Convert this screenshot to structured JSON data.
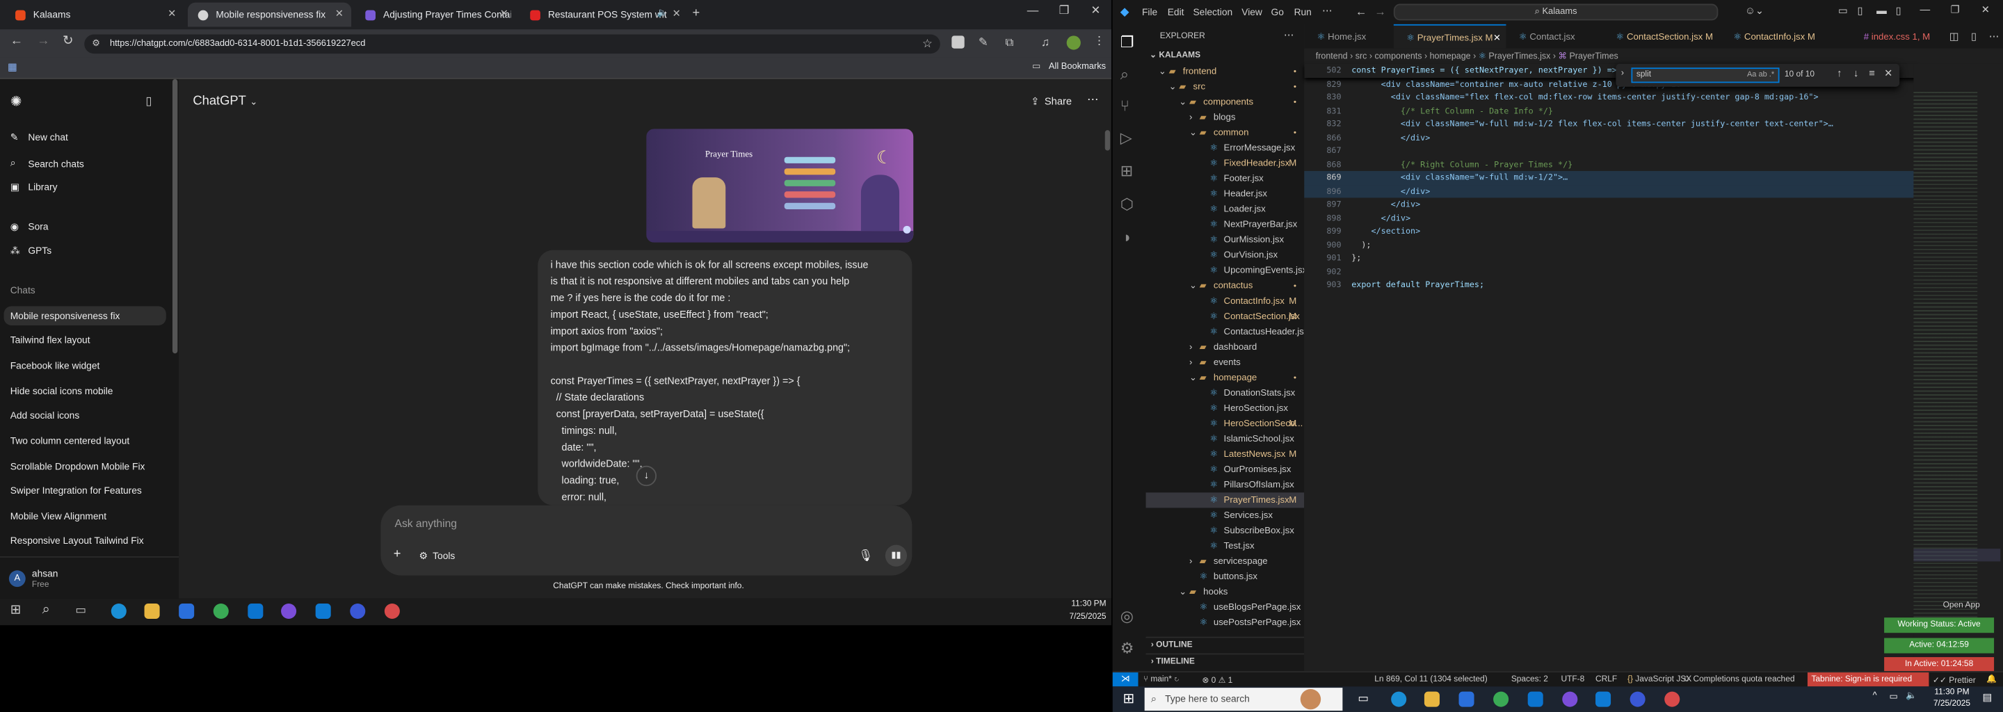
{
  "browser": {
    "tabs": [
      {
        "title": "Kalaams",
        "color": "#e84a1c"
      },
      {
        "title": "Mobile responsiveness fix",
        "color": "#d5d5d5"
      },
      {
        "title": "Adjusting Prayer Times Contain",
        "color": "#7a5bd8"
      },
      {
        "title": "Restaurant POS System wit",
        "color": "#e02424"
      }
    ],
    "url": "https://chatgpt.com/c/6883add0-6314-8001-b1d1-356619227ecd",
    "bookmarks_label": "All Bookmarks"
  },
  "chatgpt": {
    "model_label": "ChatGPT",
    "share_label": "Share",
    "nav": [
      "New chat",
      "Search chats",
      "Library",
      "Sora",
      "GPTs"
    ],
    "chats_heading": "Chats",
    "chats": [
      "Mobile responsiveness fix",
      "Tailwind flex layout",
      "Facebook like widget",
      "Hide social icons mobile",
      "Add social icons",
      "Two column centered layout",
      "Scrollable Dropdown Mobile Fix",
      "Swiper Integration for Features",
      "Mobile View Alignment",
      "Responsive Layout Tailwind Fix"
    ],
    "user": {
      "initial": "A",
      "name": "ahsan",
      "plan": "Free"
    },
    "image_title": "Prayer Times",
    "message_lines": [
      "i have this section code which is ok for all screens except mobiles, issue",
      "is that it is  not responsive at different mobiles and tabs can you help",
      "me ? if yes here is the code do it for me :",
      "import React, { useState, useEffect } from \"react\";",
      "import axios from \"axios\";",
      "import bgImage from \"../../assets/images/Homepage/namazbg.png\";",
      "",
      "const PrayerTimes = ({ setNextPrayer, nextPrayer }) => {",
      "  // State declarations",
      "  const [prayerData, setPrayerData] = useState({",
      "    timings: null,",
      "    date: \"\",",
      "    worldwideDate: \"\",",
      "    loading: true,",
      "    error: null,"
    ],
    "composer_placeholder": "Ask anything",
    "tools_label": "Tools",
    "disclaimer": "ChatGPT can make mistakes. Check important info."
  },
  "taskbar_left": {
    "time": "11:30 PM",
    "date": "7/25/2025"
  },
  "vscode": {
    "menu": [
      "File",
      "Edit",
      "Selection",
      "View",
      "Go",
      "Run"
    ],
    "search_box": "Kalaams",
    "explorer_title": "EXPLORER",
    "root": "KALAAMS",
    "tree": [
      {
        "label": "frontend",
        "depth": 1,
        "type": "folder-open",
        "mod": "dot"
      },
      {
        "label": "src",
        "depth": 2,
        "type": "folder-open",
        "mod": "dot"
      },
      {
        "label": "components",
        "depth": 3,
        "type": "folder-open",
        "mod": "dot"
      },
      {
        "label": "blogs",
        "depth": 4,
        "type": "folder",
        "mod": ""
      },
      {
        "label": "common",
        "depth": 4,
        "type": "folder-open",
        "mod": "dot"
      },
      {
        "label": "ErrorMessage.jsx",
        "depth": 5,
        "type": "file",
        "mod": ""
      },
      {
        "label": "FixedHeader.jsx",
        "depth": 5,
        "type": "file",
        "mod": "M"
      },
      {
        "label": "Footer.jsx",
        "depth": 5,
        "type": "file",
        "mod": ""
      },
      {
        "label": "Header.jsx",
        "depth": 5,
        "type": "file",
        "mod": ""
      },
      {
        "label": "Loader.jsx",
        "depth": 5,
        "type": "file",
        "mod": ""
      },
      {
        "label": "NextPrayerBar.jsx",
        "depth": 5,
        "type": "file",
        "mod": ""
      },
      {
        "label": "OurMission.jsx",
        "depth": 5,
        "type": "file",
        "mod": ""
      },
      {
        "label": "OurVision.jsx",
        "depth": 5,
        "type": "file",
        "mod": ""
      },
      {
        "label": "UpcomingEvents.jsx",
        "depth": 5,
        "type": "file",
        "mod": ""
      },
      {
        "label": "contactus",
        "depth": 4,
        "type": "folder-open",
        "mod": "dot"
      },
      {
        "label": "ContactInfo.jsx",
        "depth": 5,
        "type": "file",
        "mod": "M"
      },
      {
        "label": "ContactSection.jsx",
        "depth": 5,
        "type": "file",
        "mod": "M"
      },
      {
        "label": "ContactusHeader.jsx",
        "depth": 5,
        "type": "file",
        "mod": ""
      },
      {
        "label": "dashboard",
        "depth": 4,
        "type": "folder",
        "mod": ""
      },
      {
        "label": "events",
        "depth": 4,
        "type": "folder",
        "mod": ""
      },
      {
        "label": "homepage",
        "depth": 4,
        "type": "folder-open",
        "mod": "dot"
      },
      {
        "label": "DonationStats.jsx",
        "depth": 5,
        "type": "file",
        "mod": ""
      },
      {
        "label": "HeroSection.jsx",
        "depth": 5,
        "type": "file",
        "mod": ""
      },
      {
        "label": "HeroSectionSeco...",
        "depth": 5,
        "type": "file",
        "mod": "M"
      },
      {
        "label": "IslamicSchool.jsx",
        "depth": 5,
        "type": "file",
        "mod": ""
      },
      {
        "label": "LatestNews.jsx",
        "depth": 5,
        "type": "file",
        "mod": "M"
      },
      {
        "label": "OurPromises.jsx",
        "depth": 5,
        "type": "file",
        "mod": ""
      },
      {
        "label": "PillarsOfIslam.jsx",
        "depth": 5,
        "type": "file",
        "mod": ""
      },
      {
        "label": "PrayerTimes.jsx",
        "depth": 5,
        "type": "file",
        "mod": "M",
        "active": true
      },
      {
        "label": "Services.jsx",
        "depth": 5,
        "type": "file",
        "mod": ""
      },
      {
        "label": "SubscribeBox.jsx",
        "depth": 5,
        "type": "file",
        "mod": ""
      },
      {
        "label": "Test.jsx",
        "depth": 5,
        "type": "file",
        "mod": ""
      },
      {
        "label": "servicespage",
        "depth": 4,
        "type": "folder",
        "mod": ""
      },
      {
        "label": "buttons.jsx",
        "depth": 4,
        "type": "file",
        "mod": ""
      },
      {
        "label": "hooks",
        "depth": 3,
        "type": "folder-open",
        "mod": ""
      },
      {
        "label": "useBlogsPerPage.jsx",
        "depth": 4,
        "type": "file",
        "mod": ""
      },
      {
        "label": "usePostsPerPage.jsx",
        "depth": 4,
        "type": "file",
        "mod": ""
      }
    ],
    "outline_label": "OUTLINE",
    "timeline_label": "TIMELINE",
    "editor_tabs": [
      {
        "label": "Home.jsx",
        "mod": "",
        "active": false
      },
      {
        "label": "PrayerTimes.jsx",
        "mod": "M",
        "active": true
      },
      {
        "label": "Contact.jsx",
        "mod": "",
        "active": false
      },
      {
        "label": "ContactSection.jsx",
        "mod": "M",
        "active": false
      },
      {
        "label": "ContactInfo.jsx",
        "mod": "M",
        "active": false
      },
      {
        "label": "index.css",
        "mod": "1, M",
        "active": false
      }
    ],
    "breadcrumb": [
      "frontend",
      "src",
      "components",
      "homepage",
      "PrayerTimes.jsx",
      "PrayerTimes"
    ],
    "find": {
      "query": "split",
      "result": "10 of 10",
      "options": "Aa ab .*"
    },
    "code_lines": [
      {
        "n": "502",
        "t": "const PrayerTimes = ({ setNextPrayer, nextPrayer }) => {"
      },
      {
        "n": "829",
        "t": "      <div className=\"container mx-auto relative z-10 py-8 md:py-16\">"
      },
      {
        "n": "830",
        "t": "        <div className=\"flex flex-col md:flex-row items-center justify-center gap-8 md:gap-16\">"
      },
      {
        "n": "831",
        "t": "          {/* Left Column - Date Info */}"
      },
      {
        "n": "832",
        "t": "          <div className=\"w-full md:w-1/2 flex flex-col items-center justify-center text-center\">…"
      },
      {
        "n": "866",
        "t": "          </div>"
      },
      {
        "n": "867",
        "t": ""
      },
      {
        "n": "868",
        "t": "          {/* Right Column - Prayer Times */}"
      },
      {
        "n": "869",
        "t": "          <div className=\"w-full md:w-1/2\">…"
      },
      {
        "n": "896",
        "t": "          </div>"
      },
      {
        "n": "897",
        "t": "        </div>"
      },
      {
        "n": "898",
        "t": "      </div>"
      },
      {
        "n": "899",
        "t": "    </section>"
      },
      {
        "n": "900",
        "t": "  );"
      },
      {
        "n": "901",
        "t": "};"
      },
      {
        "n": "902",
        "t": ""
      },
      {
        "n": "903",
        "t": "export default PrayerTimes;"
      }
    ],
    "status": {
      "branch": "main*",
      "problems": "⊗ 0 ⚠ 1",
      "position": "Ln 869, Col 11 (1304 selected)",
      "spaces": "Spaces: 2",
      "encoding": "UTF-8",
      "eol": "CRLF",
      "language": "JavaScript JSX",
      "quota": "Completions quota reached",
      "tabnine": "Tabnine: Sign-in is required",
      "prettier": "Prettier"
    },
    "open_app": "Open App",
    "working_status": "Working Status: Active",
    "active_time": "Active: 04:12:59",
    "inactive_time": "In Active: 01:24:58"
  },
  "taskbar_right": {
    "search_placeholder": "Type here to search",
    "time": "11:30 PM",
    "date": "7/25/2025"
  }
}
